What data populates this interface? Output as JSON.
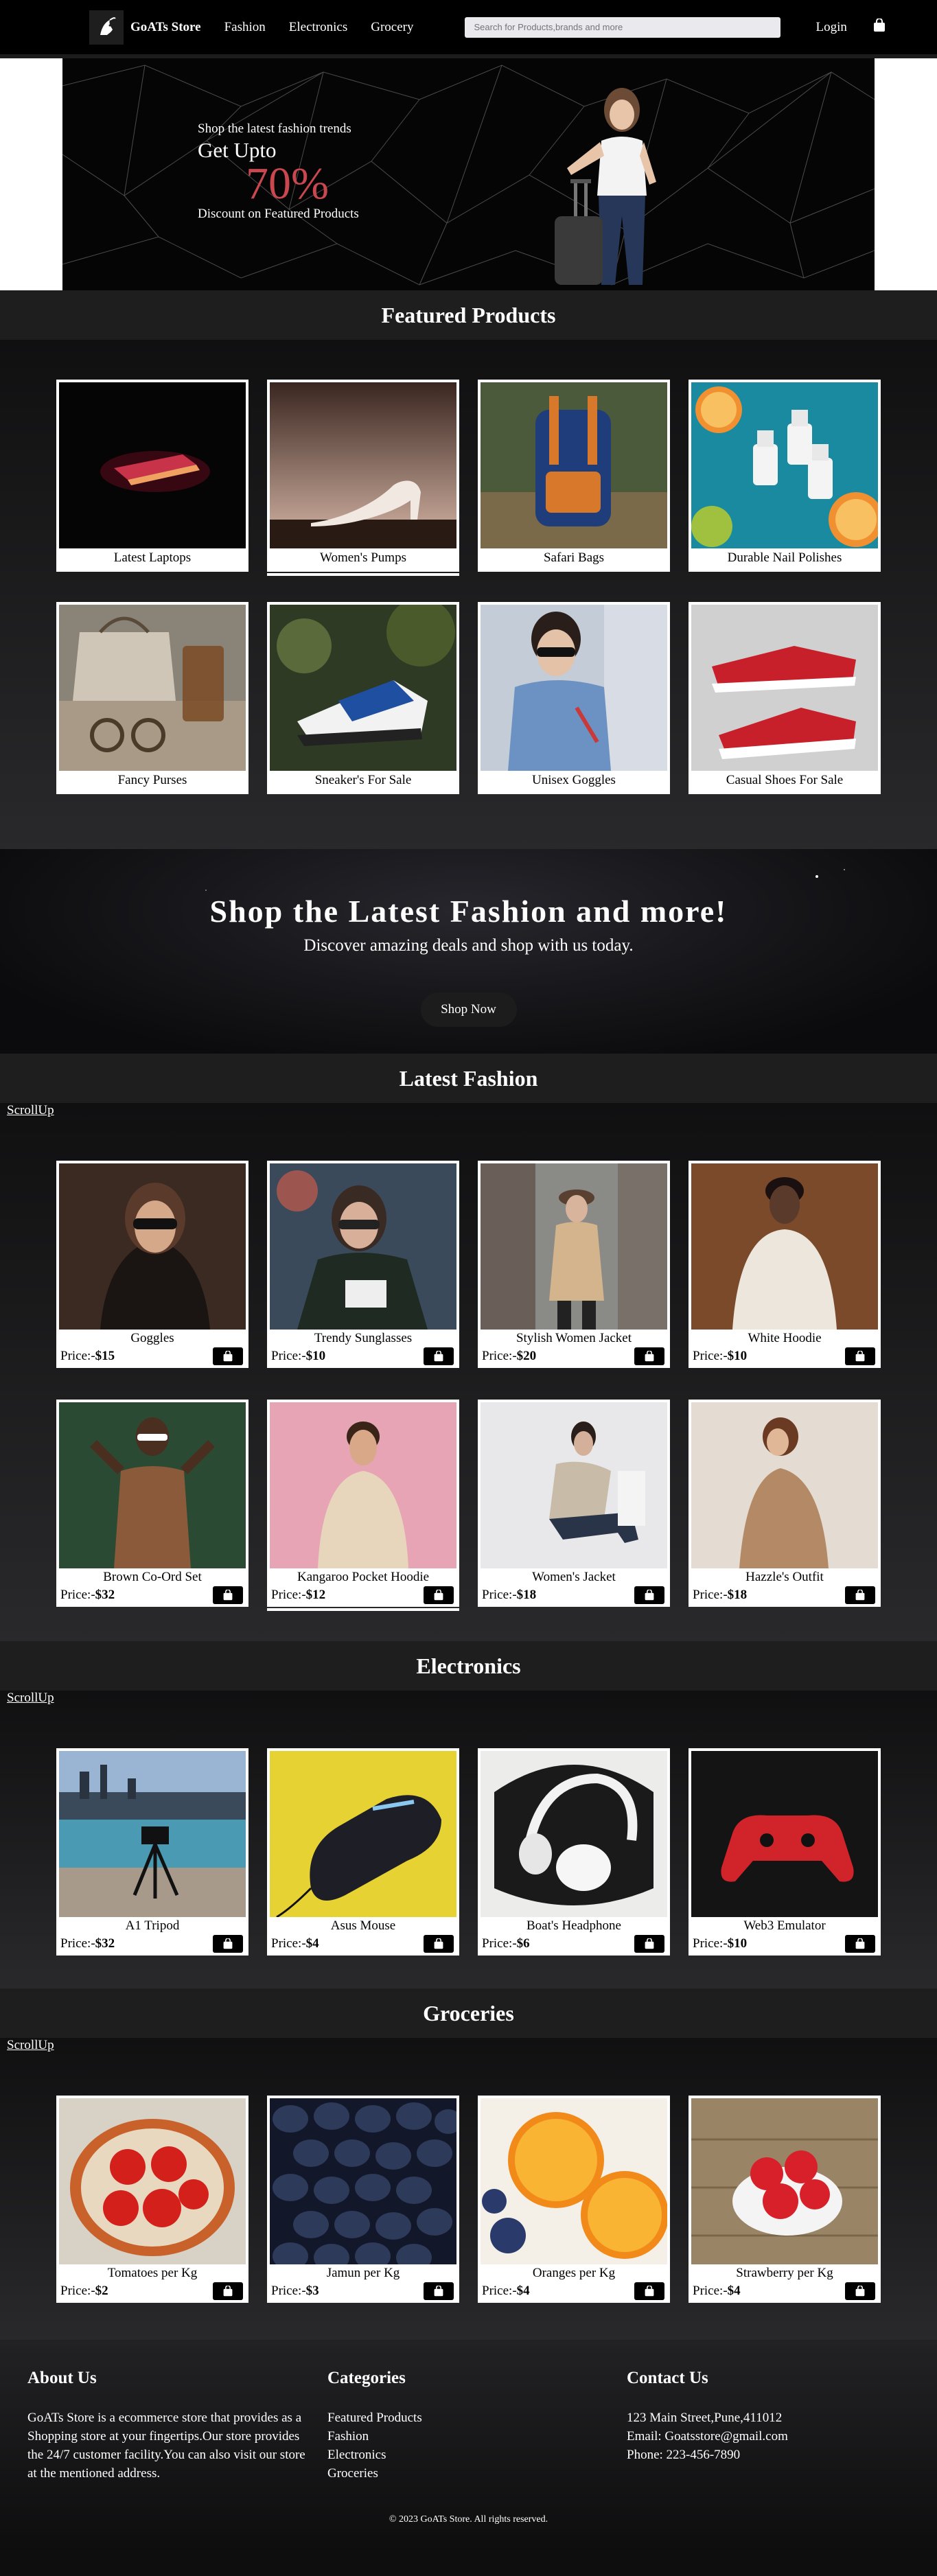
{
  "nav": {
    "brand": "GoATs Store",
    "links": [
      "Fashion",
      "Electronics",
      "Grocery"
    ],
    "search_placeholder": "Search for Products,brands and more",
    "login": "Login"
  },
  "hero": {
    "subtitle": "Shop the latest fashion trends",
    "upto": "Get Upto",
    "percent": "70%",
    "discount": "Discount on Featured Products"
  },
  "featured": {
    "title": "Featured Products",
    "items": [
      "Latest Laptops",
      "Women's Pumps",
      "Safari Bags",
      "Durable Nail Polishes",
      "Fancy Purses",
      "Sneaker's For Sale",
      "Unisex Goggles",
      "Casual Shoes For Sale"
    ]
  },
  "promo": {
    "title": "Shop the Latest Fashion and more!",
    "subtitle": "Discover amazing deals and shop with us today.",
    "button": "Shop Now"
  },
  "scrollup": "ScrollUp",
  "price_label": "Price:-",
  "fashion": {
    "title": "Latest Fashion",
    "items": [
      {
        "name": "Goggles",
        "price": "$15"
      },
      {
        "name": "Trendy Sunglasses",
        "price": "$10"
      },
      {
        "name": "Stylish Women Jacket",
        "price": "$20"
      },
      {
        "name": "White Hoodie",
        "price": "$10"
      },
      {
        "name": "Brown Co-Ord Set",
        "price": "$32"
      },
      {
        "name": "Kangaroo Pocket Hoodie",
        "price": "$12"
      },
      {
        "name": "Women's Jacket",
        "price": "$18"
      },
      {
        "name": "Hazzle's Outfit",
        "price": "$18"
      }
    ]
  },
  "electronics": {
    "title": "Electronics",
    "items": [
      {
        "name": "A1 Tripod",
        "price": "$32"
      },
      {
        "name": "Asus Mouse",
        "price": "$4"
      },
      {
        "name": "Boat's Headphone",
        "price": "$6"
      },
      {
        "name": "Web3 Emulator",
        "price": "$10"
      }
    ]
  },
  "groceries": {
    "title": "Groceries",
    "items": [
      {
        "name": "Tomatoes per Kg",
        "price": "$2"
      },
      {
        "name": "Jamun per Kg",
        "price": "$3"
      },
      {
        "name": "Oranges per Kg",
        "price": "$4"
      },
      {
        "name": "Strawberry per Kg",
        "price": "$4"
      }
    ]
  },
  "footer": {
    "about_title": "About Us",
    "about_text": "GoATs Store is a ecommerce store that provides as a Shopping store at your fingertips.Our store provides the 24/7 customer facility.You can also visit our store at the mentioned address.",
    "categories_title": "Categories",
    "categories": [
      "Featured Products",
      "Fashion",
      "Electronics",
      "Groceries"
    ],
    "contact_title": "Contact Us",
    "address": "123 Main Street,Pune,411012",
    "email": "Email: Goatsstore@gmail.com",
    "phone": "Phone: 223-456-7890",
    "copyright": "© 2023 GoATs Store. All rights reserved."
  },
  "colors": {
    "accent": "#c9474e",
    "nav_bg": "#000000",
    "section_title_bg": "#1e1e1f"
  }
}
